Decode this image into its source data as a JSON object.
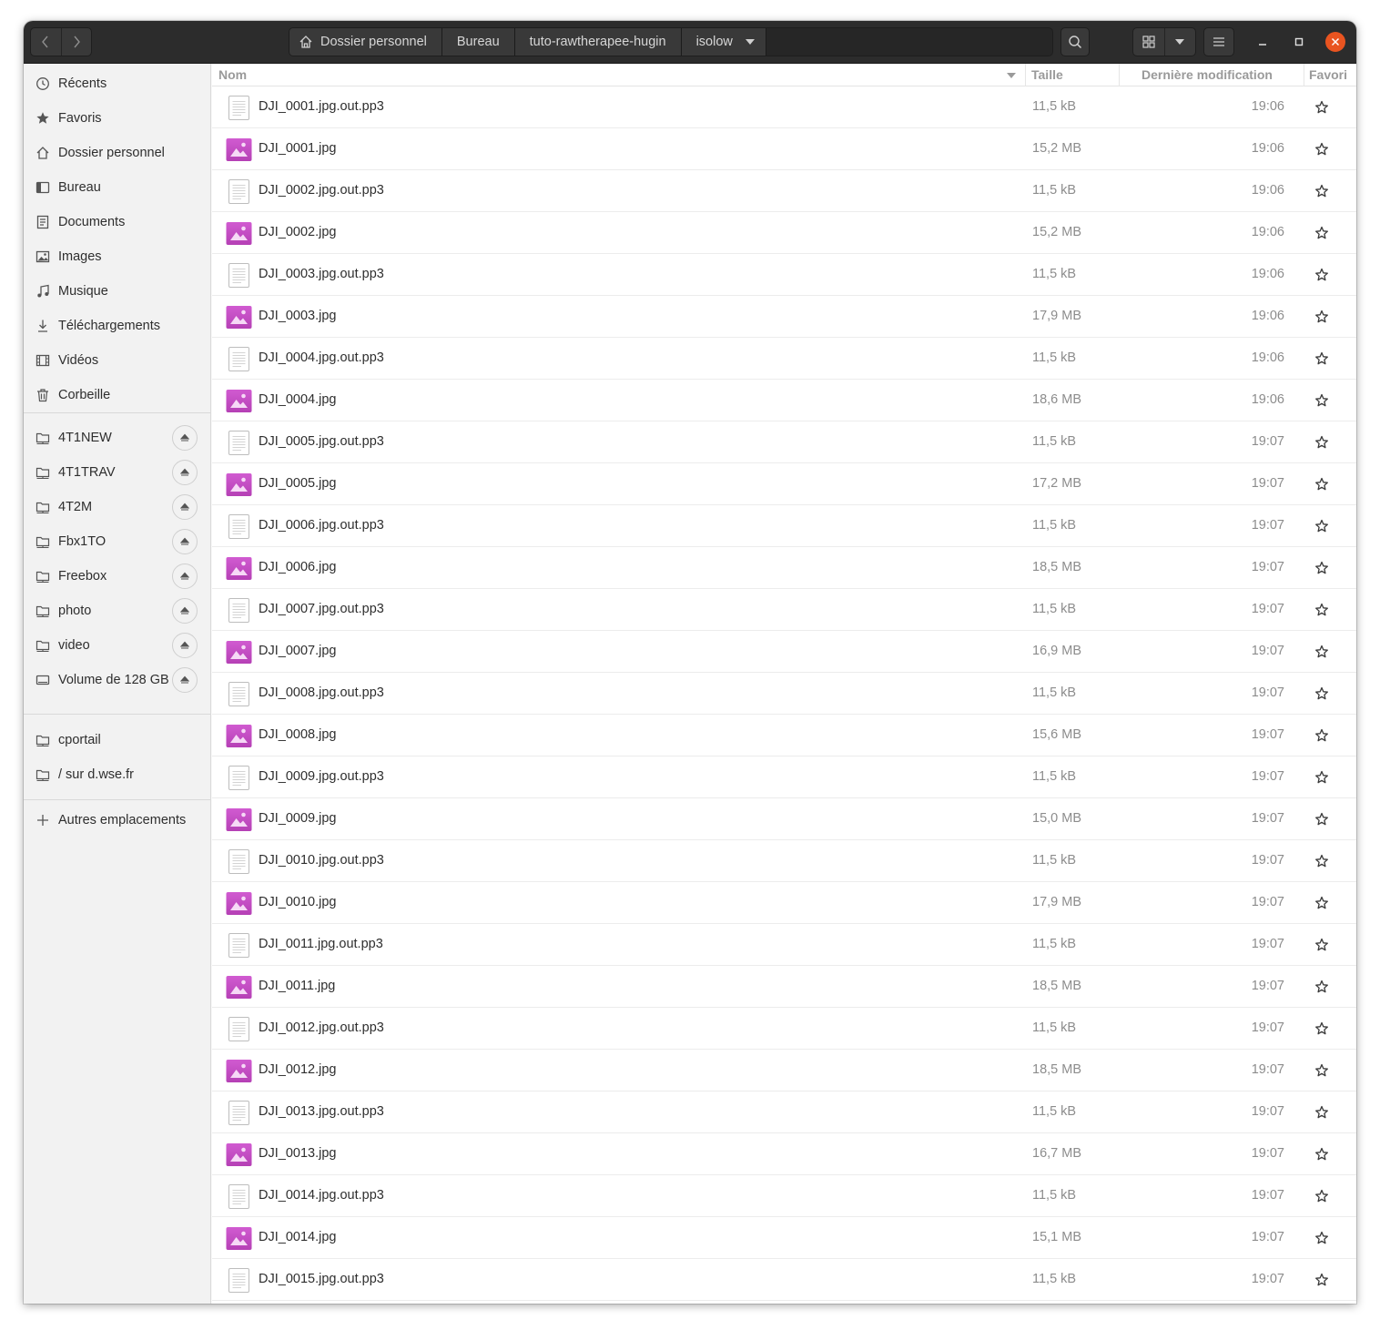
{
  "header": {
    "breadcrumbs": [
      "Dossier personnel",
      "Bureau",
      "tuto-rawtherapee-hugin",
      "isolow"
    ]
  },
  "colors": {
    "headerbar": "#2c2c2c",
    "accent_close": "#e95420",
    "image_icon": "#b540b5"
  },
  "sidebar": {
    "places": [
      {
        "label": "Récents",
        "icon": "clock-icon"
      },
      {
        "label": "Favoris",
        "icon": "star-icon"
      },
      {
        "label": "Dossier personnel",
        "icon": "home-icon"
      },
      {
        "label": "Bureau",
        "icon": "desktop-icon"
      },
      {
        "label": "Documents",
        "icon": "document-icon"
      },
      {
        "label": "Images",
        "icon": "image-icon"
      },
      {
        "label": "Musique",
        "icon": "music-icon"
      },
      {
        "label": "Téléchargements",
        "icon": "download-icon"
      },
      {
        "label": "Vidéos",
        "icon": "video-icon"
      },
      {
        "label": "Corbeille",
        "icon": "trash-icon"
      }
    ],
    "mounts": [
      {
        "label": "4T1NEW",
        "icon": "network-folder-icon"
      },
      {
        "label": "4T1TRAV",
        "icon": "network-folder-icon"
      },
      {
        "label": "4T2M",
        "icon": "network-folder-icon"
      },
      {
        "label": "Fbx1TO",
        "icon": "network-folder-icon"
      },
      {
        "label": "Freebox",
        "icon": "network-folder-icon"
      },
      {
        "label": "photo",
        "icon": "network-folder-icon"
      },
      {
        "label": "video",
        "icon": "network-folder-icon"
      },
      {
        "label": "Volume de 128 GB",
        "icon": "drive-icon"
      }
    ],
    "bookmarks": [
      {
        "label": "cportail",
        "icon": "network-folder-icon"
      },
      {
        "label": "/ sur d.wse.fr",
        "icon": "network-folder-icon"
      }
    ],
    "other_locations": "Autres emplacements"
  },
  "columns": {
    "name": "Nom",
    "size": "Taille",
    "modified": "Dernière modification",
    "starred": "Favori"
  },
  "files": [
    {
      "name": "DJI_0001.jpg.out.pp3",
      "type": "text",
      "size": "11,5 kB",
      "modified": "19:06"
    },
    {
      "name": "DJI_0001.jpg",
      "type": "image",
      "size": "15,2 MB",
      "modified": "19:06"
    },
    {
      "name": "DJI_0002.jpg.out.pp3",
      "type": "text",
      "size": "11,5 kB",
      "modified": "19:06"
    },
    {
      "name": "DJI_0002.jpg",
      "type": "image",
      "size": "15,2 MB",
      "modified": "19:06"
    },
    {
      "name": "DJI_0003.jpg.out.pp3",
      "type": "text",
      "size": "11,5 kB",
      "modified": "19:06"
    },
    {
      "name": "DJI_0003.jpg",
      "type": "image",
      "size": "17,9 MB",
      "modified": "19:06"
    },
    {
      "name": "DJI_0004.jpg.out.pp3",
      "type": "text",
      "size": "11,5 kB",
      "modified": "19:06"
    },
    {
      "name": "DJI_0004.jpg",
      "type": "image",
      "size": "18,6 MB",
      "modified": "19:06"
    },
    {
      "name": "DJI_0005.jpg.out.pp3",
      "type": "text",
      "size": "11,5 kB",
      "modified": "19:07"
    },
    {
      "name": "DJI_0005.jpg",
      "type": "image",
      "size": "17,2 MB",
      "modified": "19:07"
    },
    {
      "name": "DJI_0006.jpg.out.pp3",
      "type": "text",
      "size": "11,5 kB",
      "modified": "19:07"
    },
    {
      "name": "DJI_0006.jpg",
      "type": "image",
      "size": "18,5 MB",
      "modified": "19:07"
    },
    {
      "name": "DJI_0007.jpg.out.pp3",
      "type": "text",
      "size": "11,5 kB",
      "modified": "19:07"
    },
    {
      "name": "DJI_0007.jpg",
      "type": "image",
      "size": "16,9 MB",
      "modified": "19:07"
    },
    {
      "name": "DJI_0008.jpg.out.pp3",
      "type": "text",
      "size": "11,5 kB",
      "modified": "19:07"
    },
    {
      "name": "DJI_0008.jpg",
      "type": "image",
      "size": "15,6 MB",
      "modified": "19:07"
    },
    {
      "name": "DJI_0009.jpg.out.pp3",
      "type": "text",
      "size": "11,5 kB",
      "modified": "19:07"
    },
    {
      "name": "DJI_0009.jpg",
      "type": "image",
      "size": "15,0 MB",
      "modified": "19:07"
    },
    {
      "name": "DJI_0010.jpg.out.pp3",
      "type": "text",
      "size": "11,5 kB",
      "modified": "19:07"
    },
    {
      "name": "DJI_0010.jpg",
      "type": "image",
      "size": "17,9 MB",
      "modified": "19:07"
    },
    {
      "name": "DJI_0011.jpg.out.pp3",
      "type": "text",
      "size": "11,5 kB",
      "modified": "19:07"
    },
    {
      "name": "DJI_0011.jpg",
      "type": "image",
      "size": "18,5 MB",
      "modified": "19:07"
    },
    {
      "name": "DJI_0012.jpg.out.pp3",
      "type": "text",
      "size": "11,5 kB",
      "modified": "19:07"
    },
    {
      "name": "DJI_0012.jpg",
      "type": "image",
      "size": "18,5 MB",
      "modified": "19:07"
    },
    {
      "name": "DJI_0013.jpg.out.pp3",
      "type": "text",
      "size": "11,5 kB",
      "modified": "19:07"
    },
    {
      "name": "DJI_0013.jpg",
      "type": "image",
      "size": "16,7 MB",
      "modified": "19:07"
    },
    {
      "name": "DJI_0014.jpg.out.pp3",
      "type": "text",
      "size": "11,5 kB",
      "modified": "19:07"
    },
    {
      "name": "DJI_0014.jpg",
      "type": "image",
      "size": "15,1 MB",
      "modified": "19:07"
    },
    {
      "name": "DJI_0015.jpg.out.pp3",
      "type": "text",
      "size": "11,5 kB",
      "modified": "19:07"
    }
  ]
}
